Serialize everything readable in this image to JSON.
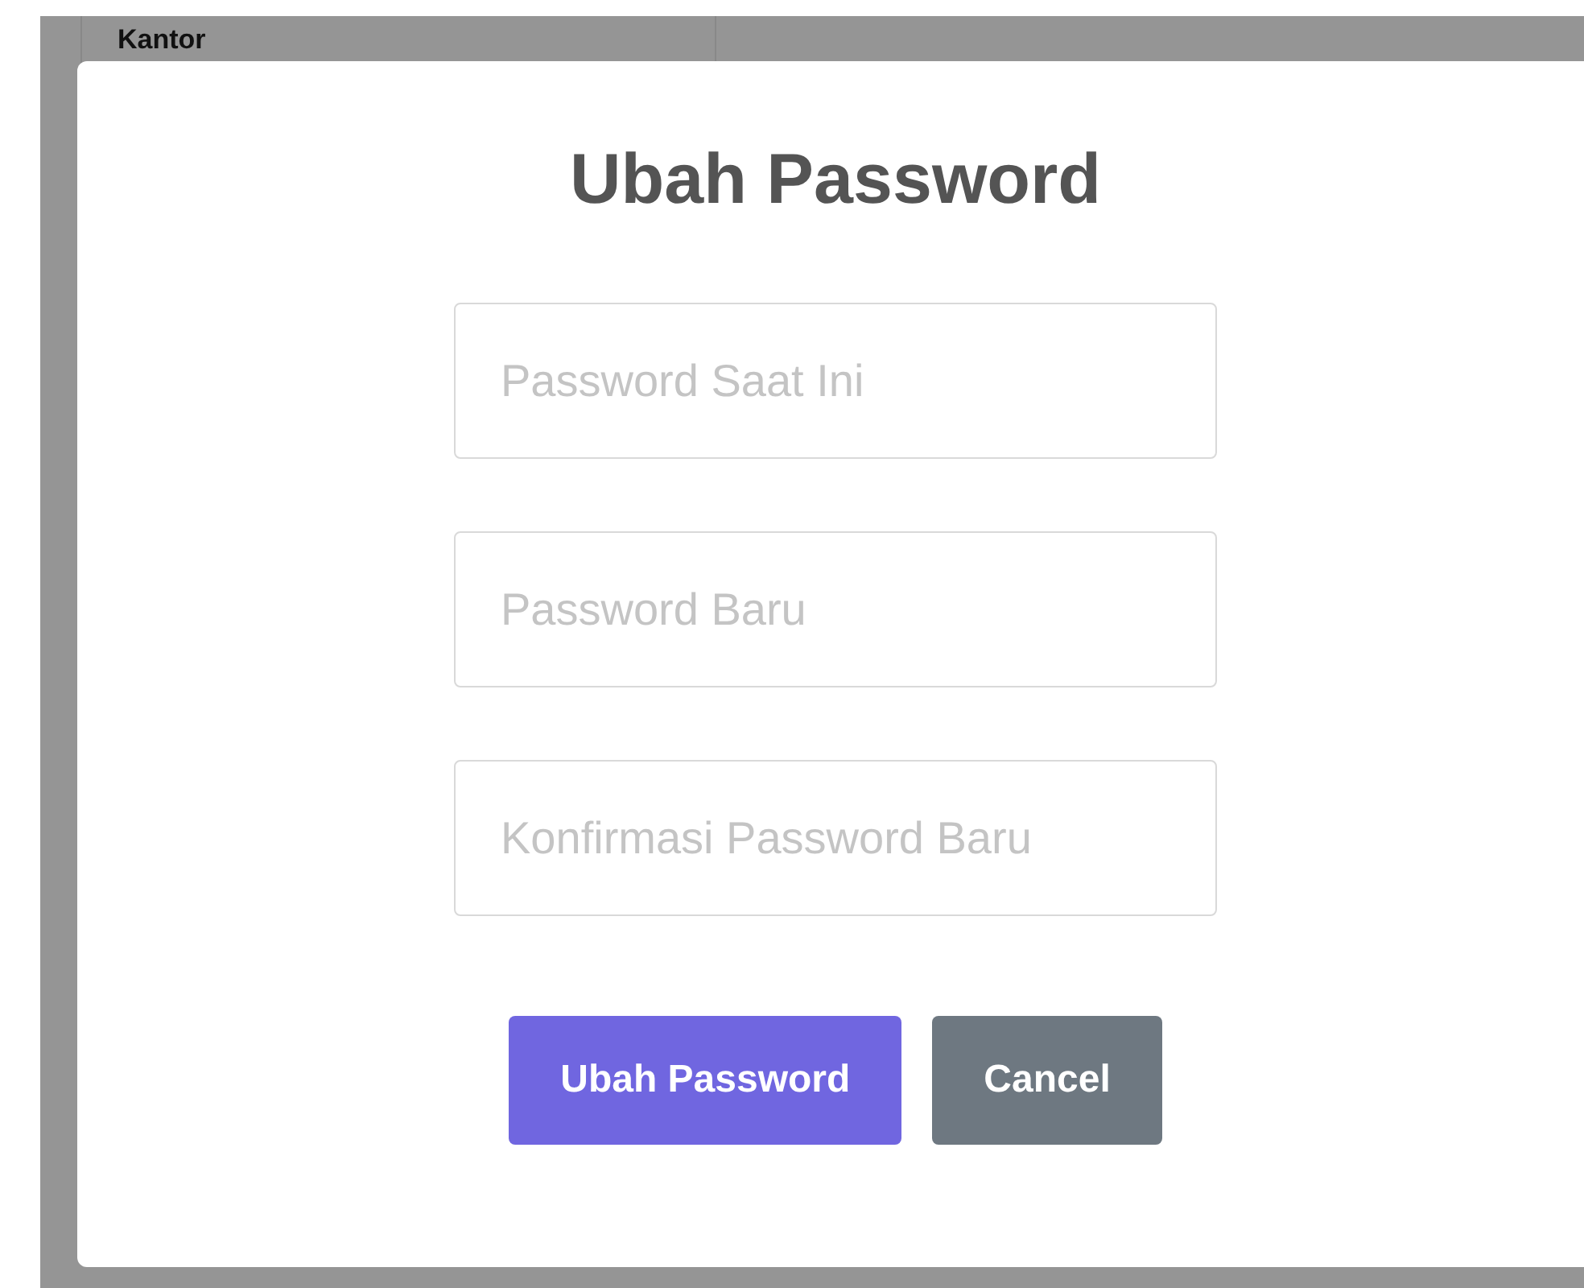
{
  "background": {
    "label": "Kantor"
  },
  "dialog": {
    "title": "Ubah Password",
    "fields": [
      {
        "placeholder": "Password Saat Ini"
      },
      {
        "placeholder": "Password Baru"
      },
      {
        "placeholder": "Konfirmasi Password Baru"
      }
    ],
    "buttons": [
      {
        "label": "Ubah Password",
        "kind": "confirm"
      },
      {
        "label": "Cancel",
        "kind": "cancel"
      }
    ]
  }
}
